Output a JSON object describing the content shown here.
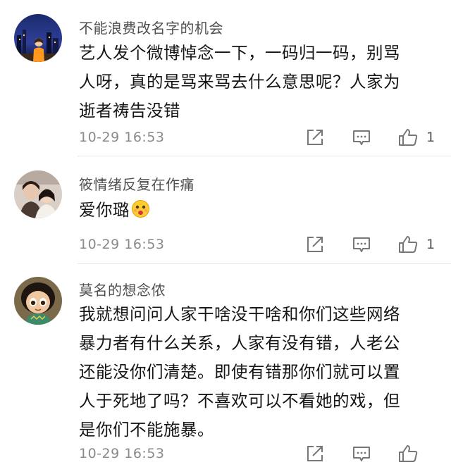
{
  "comments": [
    {
      "username": "不能浪费改名字的机会",
      "lines": [
        "艺人发个微博悼念一下，一码归一码，别骂",
        "人呀，真的是骂来骂去什么意思呢？人家为",
        "逝者祷告没错"
      ],
      "time": "10-29 16:53",
      "likes": "1",
      "avatar_icon": "city-night-avatar-icon"
    },
    {
      "username": "筱情绪反复在作痛",
      "lines": [
        "爱你璐"
      ],
      "emoji_icon": "drooling-face-emoji-icon",
      "time": "10-29 16:53",
      "likes": "1",
      "avatar_icon": "couple-photo-avatar-icon"
    },
    {
      "username": "莫名的想念侬",
      "lines": [
        "我就想问问人家干啥没干啥和你们这些网络",
        "暴力者有什么关系，人家有没有错，人老公",
        "还能没你们清楚。即使有错那你们就可以置",
        "人于死地了吗？不喜欢可以不看她的戏，但",
        "是你们不能施暴。"
      ],
      "time": "10-29 16:53",
      "avatar_icon": "cartoon-girl-avatar-icon"
    }
  ],
  "colors": {
    "username": "#505050",
    "text": "#151515",
    "meta": "#8a8a8a",
    "icon": "#777777",
    "divider": "#e6e6e6"
  }
}
